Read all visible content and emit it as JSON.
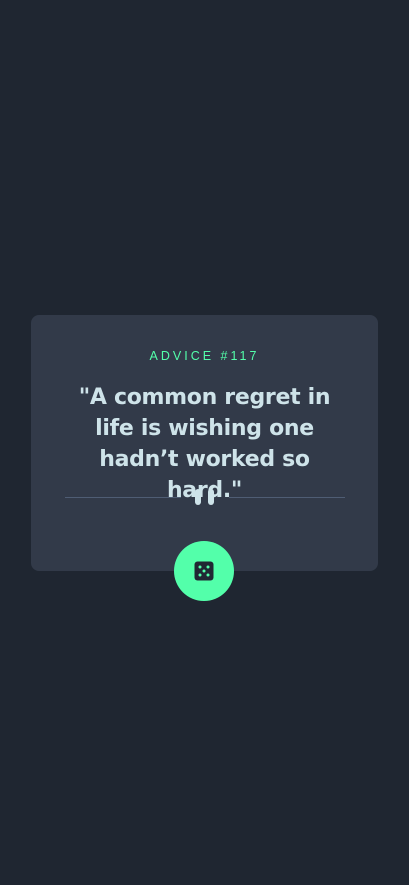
{
  "advice": {
    "id_label": "ADVICE #117",
    "quote": "\"A common regret in life is wishing one hadn’t worked so hard.\""
  },
  "icons": {
    "divider": "pause-icon",
    "button": "dice-icon"
  },
  "colors": {
    "background": "#1f2631",
    "card": "#323a49",
    "accent": "#53ffaa",
    "text": "#cee3e9",
    "divider": "#4f5d74"
  }
}
